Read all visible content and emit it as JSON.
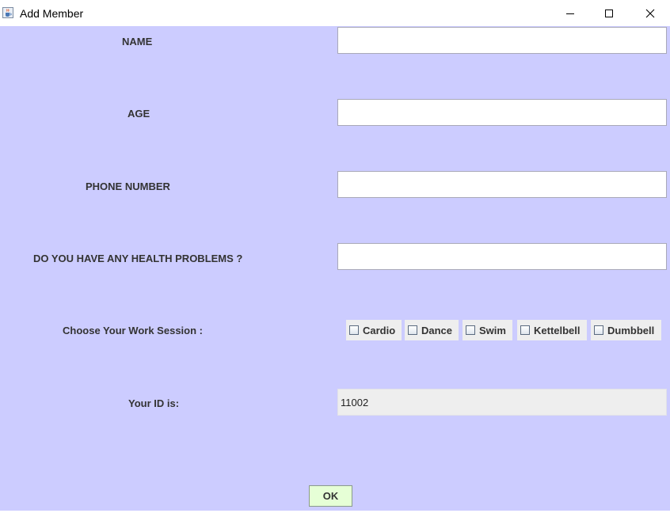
{
  "window": {
    "title": "Add Member",
    "icon": "java-cup-icon",
    "controls": [
      "minimize-icon",
      "maximize-icon",
      "close-icon"
    ]
  },
  "form": {
    "name": {
      "label": "NAME",
      "value": ""
    },
    "age": {
      "label": "AGE",
      "value": ""
    },
    "phone": {
      "label": "PHONE NUMBER",
      "value": ""
    },
    "health": {
      "label": "DO YOU HAVE ANY HEALTH PROBLEMS ?",
      "value": ""
    },
    "sessions": {
      "label": "Choose Your Work Session :",
      "options": [
        {
          "label": "Cardio",
          "checked": false
        },
        {
          "label": "Dance",
          "checked": false
        },
        {
          "label": "Swim",
          "checked": false
        },
        {
          "label": "Kettelbell",
          "checked": false
        },
        {
          "label": "Dumbbell",
          "checked": false
        }
      ]
    },
    "id": {
      "label": "Your ID is:",
      "value": "11002"
    },
    "ok_label": "OK"
  },
  "colors": {
    "background": "#ccccff",
    "ok_button": "#e6ffd6",
    "checkbox_bg": "#eeeeee",
    "label_text": "#333333"
  }
}
